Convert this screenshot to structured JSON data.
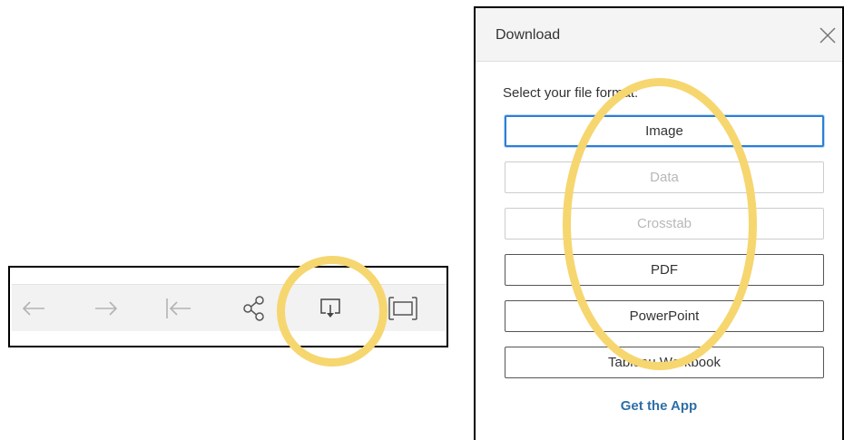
{
  "toolbar": {
    "buttons": [
      {
        "icon": "undo-arrow-icon",
        "state": "disabled"
      },
      {
        "icon": "redo-arrow-icon",
        "state": "disabled"
      },
      {
        "icon": "revert-icon",
        "state": "disabled"
      },
      {
        "icon": "share-icon",
        "state": "enabled"
      },
      {
        "icon": "download-icon",
        "state": "enabled",
        "highlighted": true
      },
      {
        "icon": "full-screen-icon",
        "state": "enabled"
      }
    ]
  },
  "dialog": {
    "title": "Download",
    "prompt": "Select your file format:",
    "formats": [
      {
        "label": "Image",
        "state": "selected"
      },
      {
        "label": "Data",
        "state": "disabled"
      },
      {
        "label": "Crosstab",
        "state": "disabled"
      },
      {
        "label": "PDF",
        "state": "enabled"
      },
      {
        "label": "PowerPoint",
        "state": "enabled"
      },
      {
        "label": "Tableau Workbook",
        "state": "enabled"
      }
    ],
    "get_app_link": "Get the App"
  },
  "colors": {
    "highlight": "#f6d66f",
    "selected_border": "#2c7fd6",
    "link": "#2e6fa7",
    "disabled_text": "#b8b8b8"
  }
}
